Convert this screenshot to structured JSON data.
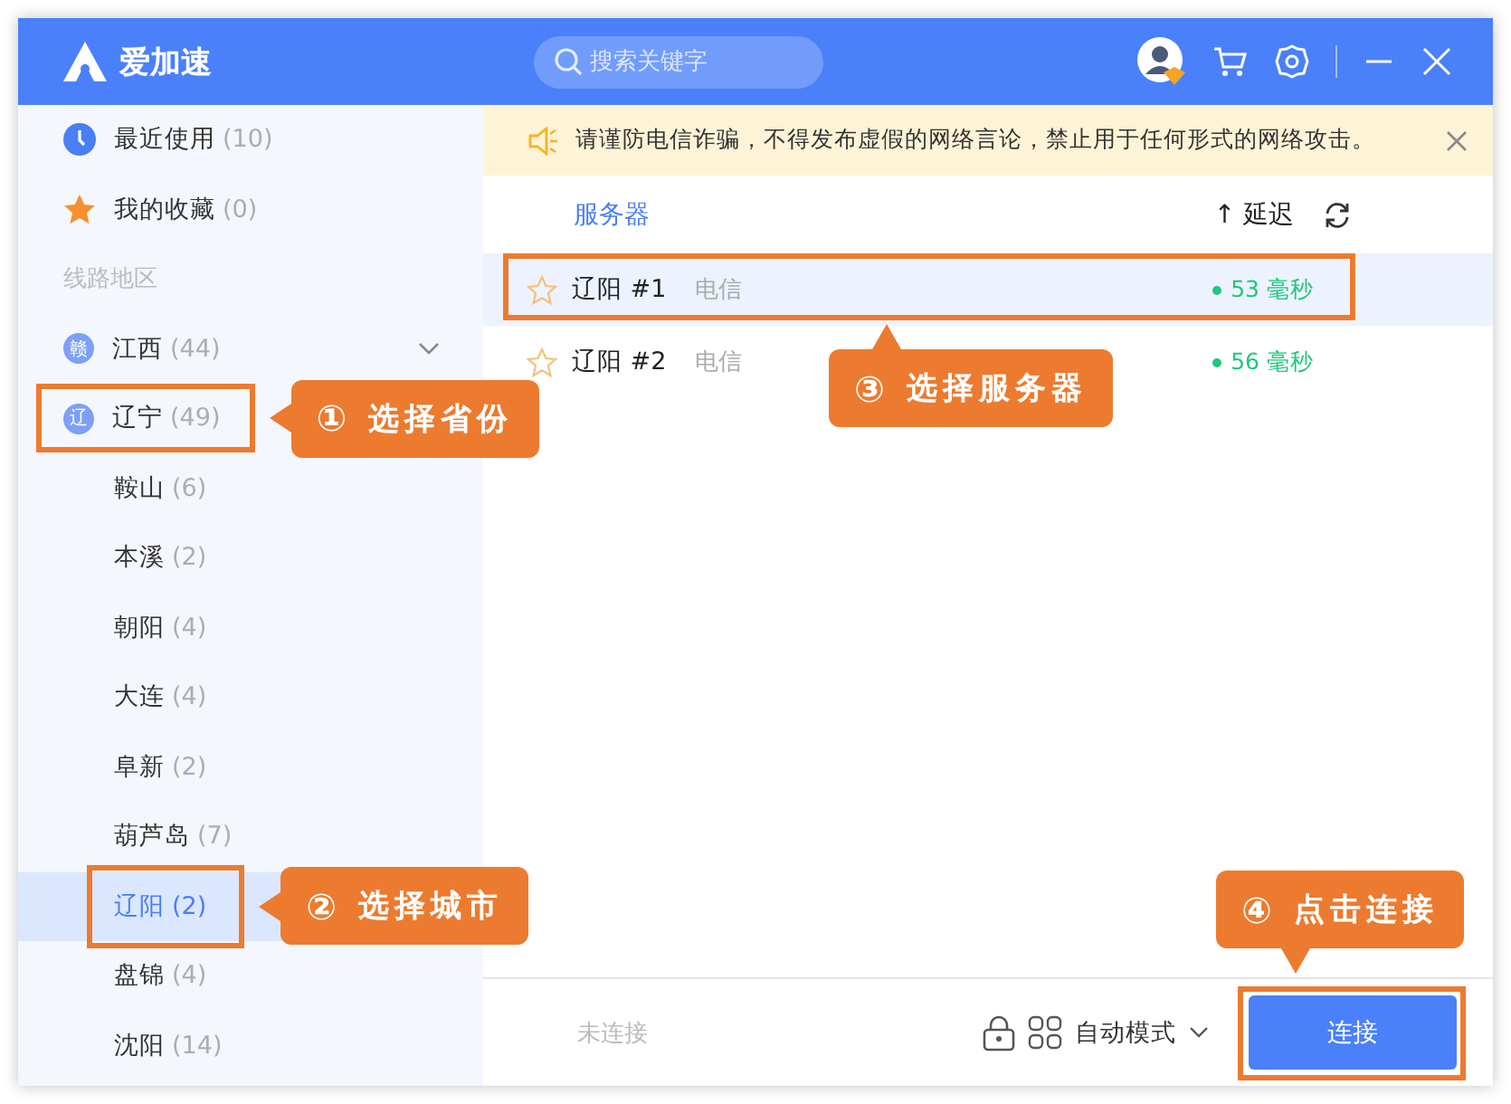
{
  "window": {
    "title": "爱加速"
  },
  "search": {
    "placeholder": "搜索关键字"
  },
  "sidebar": {
    "quick_items": [
      {
        "kind": "recent",
        "label": "最近使用",
        "count": "(10)"
      },
      {
        "kind": "favorites",
        "label": "我的收藏",
        "count": "(0)"
      }
    ],
    "section_title": "线路地区",
    "provinces": [
      {
        "badge": "赣",
        "label": "江西",
        "count": "(44)"
      },
      {
        "badge": "辽",
        "label": "辽宁",
        "count": "(49)",
        "callout": {
          "step": "①",
          "text": "选择省份"
        },
        "children": [
          {
            "label": "鞍山",
            "count": "(6)",
            "selected": false
          },
          {
            "label": "本溪",
            "count": "(2)",
            "selected": false
          },
          {
            "label": "朝阳",
            "count": "(4)",
            "selected": false
          },
          {
            "label": "大连",
            "count": "(4)",
            "selected": false
          },
          {
            "label": "阜新",
            "count": "(2)",
            "selected": false
          },
          {
            "label": "葫芦岛",
            "count": "(7)",
            "selected": false
          },
          {
            "label": "辽阳",
            "count": "(2)",
            "selected": true,
            "callout": {
              "step": "②",
              "text": "选择城市"
            }
          },
          {
            "label": "盘锦",
            "count": "(4)",
            "selected": false
          },
          {
            "label": "沈阳",
            "count": "(14)",
            "selected": false
          }
        ]
      }
    ]
  },
  "notice": {
    "text": "请谨防电信诈骗，不得发布虚假的网络言论，禁止用于任何形式的网络攻击。"
  },
  "server_list": {
    "column": "服务器",
    "sort": "↑ 延迟",
    "servers": [
      {
        "name": "辽阳 #1",
        "isp": "电信",
        "latency": "53 毫秒",
        "favorite": false,
        "selected": true,
        "callout": {
          "step": "③",
          "text": "选择服务器"
        }
      },
      {
        "name": "辽阳 #2",
        "isp": "电信",
        "latency": "56 毫秒",
        "favorite": false,
        "selected": false
      }
    ]
  },
  "footer": {
    "status": "未连接",
    "mode": "自动模式",
    "connect_button": "连接",
    "callout": {
      "step": "④",
      "text": "点击连接"
    }
  }
}
